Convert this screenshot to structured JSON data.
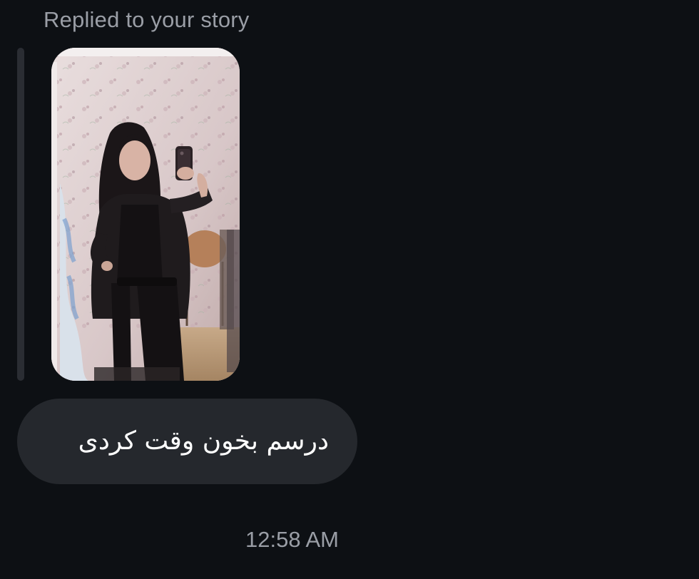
{
  "reply_header": "Replied to your story",
  "story": {
    "image_icon": "story-photo"
  },
  "message": {
    "text": "درسم بخون وقت کردی"
  },
  "timestamp": "12:58 AM",
  "colors": {
    "background": "#0d1014",
    "bubble": "#25282d",
    "quote_bar": "#2a2d33",
    "muted_text": "#9a9ea6",
    "message_text": "#ffffff"
  }
}
